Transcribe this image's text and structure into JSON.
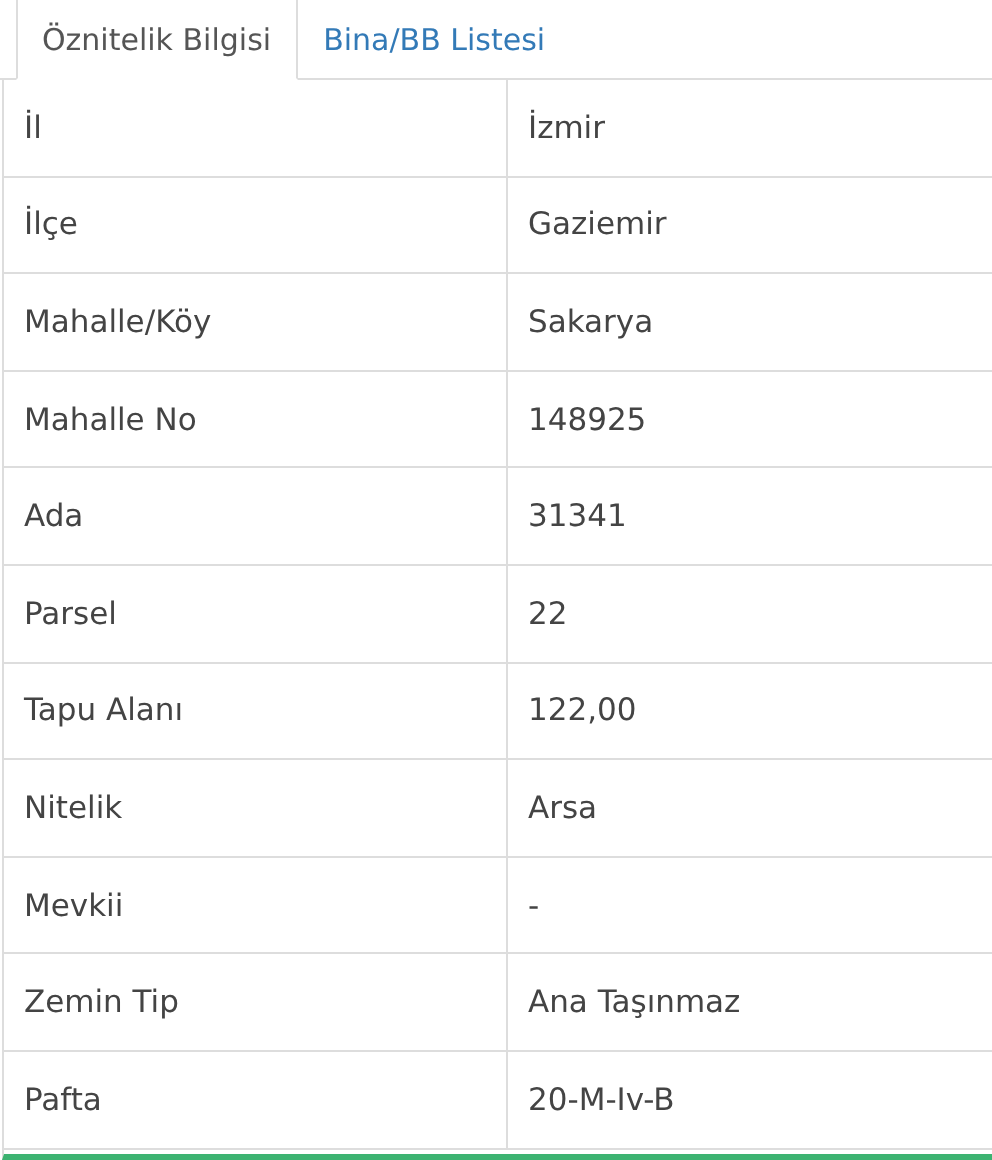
{
  "tabs": [
    {
      "label": "Öznitelik Bilgisi",
      "selected": true
    },
    {
      "label": "Bina/BB Listesi",
      "selected": false
    }
  ],
  "table": {
    "rows": [
      {
        "label": "İl",
        "value": "İzmir"
      },
      {
        "label": "İlçe",
        "value": "Gaziemir"
      },
      {
        "label": "Mahalle/Köy",
        "value": "Sakarya"
      },
      {
        "label": "Mahalle No",
        "value": "148925"
      },
      {
        "label": "Ada",
        "value": "31341"
      },
      {
        "label": "Parsel",
        "value": "22"
      },
      {
        "label": "Tapu Alanı",
        "value": "122,00"
      },
      {
        "label": "Nitelik",
        "value": "Arsa"
      },
      {
        "label": "Mevkii",
        "value": "-"
      },
      {
        "label": "Zemin Tip",
        "value": "Ana Taşınmaz"
      },
      {
        "label": "Pafta",
        "value": "20-M-Iv-B"
      }
    ]
  }
}
